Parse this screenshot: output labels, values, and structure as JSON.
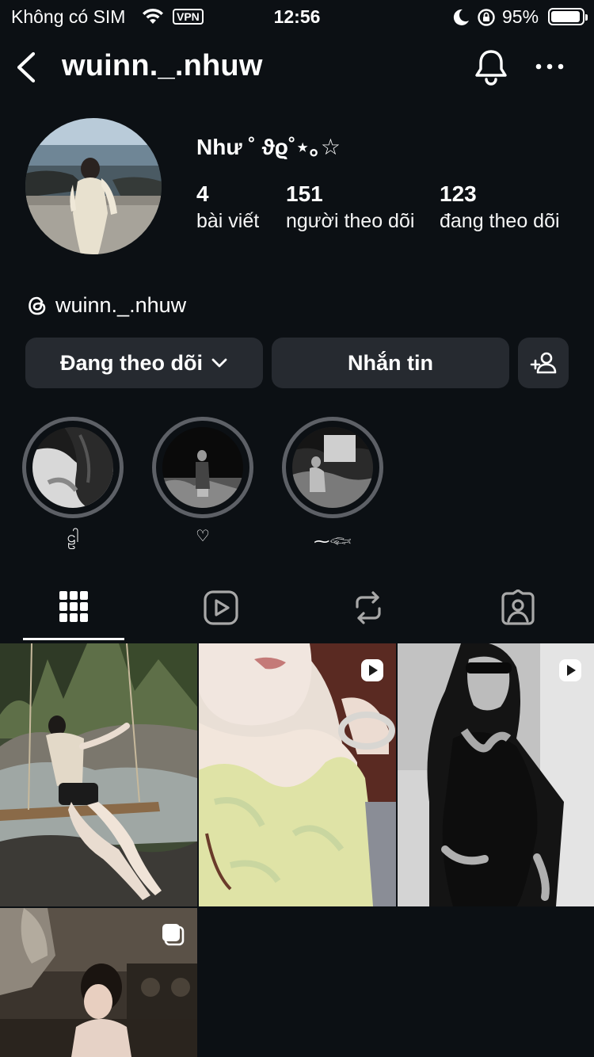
{
  "status_bar": {
    "carrier": "Không có SIM",
    "vpn": "VPN",
    "time": "12:56",
    "battery_percent": "95%",
    "battery_level": 0.95
  },
  "header": {
    "username": "wuinn._.nhuw",
    "icons": [
      "chevron-left-icon",
      "bell-icon",
      "more-horizontal-icon"
    ]
  },
  "profile": {
    "display_name": "Như ˚ ϑϱ˚⋆｡☆",
    "stats": [
      {
        "value": "4",
        "label": "bài viết"
      },
      {
        "value": "151",
        "label": "người theo dõi"
      },
      {
        "value": "123",
        "label": "đang theo dõi"
      }
    ],
    "threads_handle": "wuinn._.nhuw"
  },
  "actions": {
    "following_label": "Đang theo dõi",
    "message_label": "Nhắn tin"
  },
  "highlights": [
    {
      "label": "ဠါ"
    },
    {
      "label": "♡"
    },
    {
      "label": "⁓𓆟"
    }
  ],
  "tabs": [
    {
      "name": "posts",
      "icon": "grid-icon",
      "active": true
    },
    {
      "name": "reels",
      "icon": "reels-icon",
      "active": false
    },
    {
      "name": "reposts",
      "icon": "repost-icon",
      "active": false
    },
    {
      "name": "tagged",
      "icon": "tagged-icon",
      "active": false
    }
  ],
  "posts": [
    {
      "type": "photo",
      "badge": null
    },
    {
      "type": "reel",
      "badge": "reel-icon"
    },
    {
      "type": "reel",
      "badge": "reel-icon"
    },
    {
      "type": "carousel",
      "badge": "carousel-icon"
    }
  ],
  "colors": {
    "background": "#0c1014",
    "button": "#262a30",
    "highlight_ring": "#5d6066",
    "text": "#ffffff"
  }
}
